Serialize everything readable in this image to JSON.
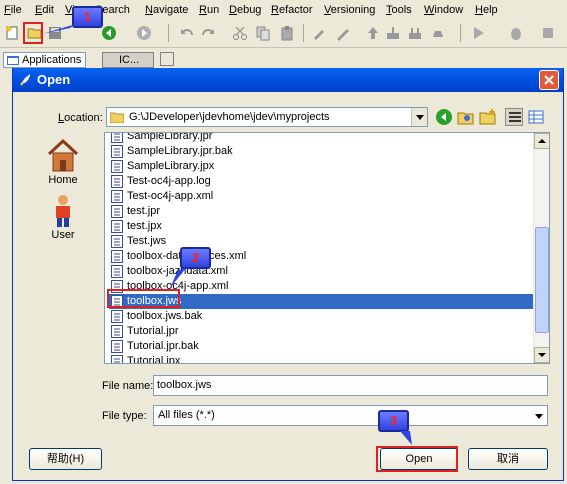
{
  "menubar": {
    "items": [
      "File",
      "Edit",
      "View",
      "Search",
      "Navigate",
      "Run",
      "Debug",
      "Refactor",
      "Versioning",
      "Tools",
      "Window",
      "Help"
    ]
  },
  "panel": {
    "applications_tab": "Applications",
    "second_tab": "IC..."
  },
  "dialog": {
    "title": "Open",
    "location_label": "Location:",
    "location_value": "G:\\JDeveloper\\jdevhome\\jdev\\myprojects",
    "places": [
      {
        "label": "Home",
        "icon": "home-icon"
      },
      {
        "label": "User",
        "icon": "user-icon"
      }
    ],
    "files": [
      "SampleLibrary.jpr",
      "SampleLibrary.jpr.bak",
      "SampleLibrary.jpx",
      "Test-oc4j-app.log",
      "Test-oc4j-app.xml",
      "test.jpr",
      "test.jpx",
      "Test.jws",
      "toolbox-datasources.xml",
      "toolbox-jazndata.xml",
      "toolbox-oc4j-app.xml",
      "toolbox.jws",
      "toolbox.jws.bak",
      "Tutorial.jpr",
      "Tutorial.jpr.bak",
      "Tutorial.jpx"
    ],
    "selected_file": "toolbox.jws",
    "file_name_label": "File name:",
    "file_name_value": "toolbox.jws",
    "file_type_label": "File type:",
    "file_type_value": "All files (*.*)",
    "help_button": "帮助(H)",
    "open_button": "Open",
    "cancel_button": "取消"
  },
  "callouts": [
    "1",
    "2",
    "3"
  ],
  "colors": {
    "title_bar": "#0354e3",
    "selection": "#316ac5",
    "callout": "#2f44e0",
    "highlight_box": "#e02020"
  }
}
